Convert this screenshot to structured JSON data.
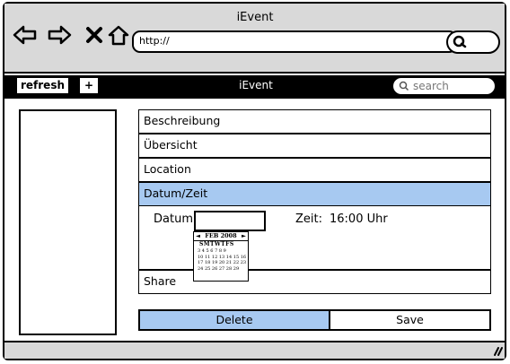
{
  "window": {
    "title": "iEvent"
  },
  "navigation": {
    "icons": [
      "back-arrow-icon",
      "forward-arrow-icon",
      "close-icon",
      "home-icon"
    ],
    "url": "http://"
  },
  "toolbar": {
    "refresh_label": "refresh",
    "add_label": "+",
    "title": "iEvent",
    "search_placeholder": "search"
  },
  "accordion": {
    "items": [
      {
        "label": "Beschreibung",
        "active": false
      },
      {
        "label": "Übersicht",
        "active": false
      },
      {
        "label": "Location",
        "active": false
      },
      {
        "label": "Datum/Zeit",
        "active": true
      },
      {
        "label": "Share",
        "active": false
      }
    ]
  },
  "datetime": {
    "datum_label": "Datum",
    "zeit_label": "Zeit:",
    "zeit_value": "16:00 Uhr"
  },
  "calendar": {
    "month": "FEB 2008",
    "prev": "◄",
    "next": "►",
    "weekdays": "SMTWTFS",
    "weeks": [
      "3 4 5 6 7 8 9",
      "10 11 12 13 14 15 16",
      "17 18 19 20 21 22 23",
      "24 25 26 27 28 29"
    ]
  },
  "buttons": {
    "delete_label": "Delete",
    "save_label": "Save"
  },
  "colors": {
    "selection": "#a7c9f1",
    "chrome": "#d9d9d9",
    "appbar": "#000000"
  }
}
